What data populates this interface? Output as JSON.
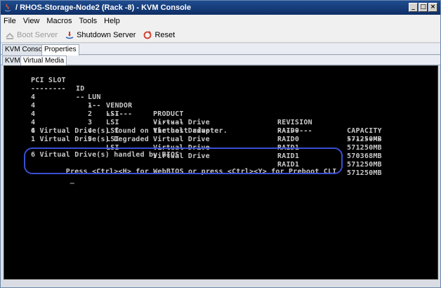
{
  "window": {
    "title": "/ RHOS-Storage-Node2 (Rack -8) - KVM Console",
    "controls": [
      "_",
      "□",
      "×"
    ]
  },
  "menu": {
    "items": [
      "File",
      "View",
      "Macros",
      "Tools",
      "Help"
    ]
  },
  "toolbar": {
    "boot_server": "Boot Server",
    "shutdown_server": "Shutdown Server",
    "reset": "Reset"
  },
  "tabs": {
    "top": [
      "KVM Console",
      "Properties"
    ],
    "sub": [
      "KVM",
      "Virtual Media"
    ]
  },
  "console": {
    "headers": [
      "PCI SLOT",
      "ID",
      "LUN",
      "VENDOR",
      "PRODUCT",
      "REVISION",
      "CAPACITY"
    ],
    "header_rule": [
      "--------",
      "--",
      "---",
      "------",
      "-------",
      "--------",
      "--------"
    ],
    "rows": [
      {
        "slot": "4",
        "id": "",
        "lun": "1",
        "vendor": "LSI",
        "product": "Virtual Drive",
        "revision": "RAID0",
        "capacity": "571250MB"
      },
      {
        "slot": "4",
        "id": "",
        "lun": "2",
        "vendor": "LSI",
        "product": "Virtual Drive",
        "revision": "RAID0",
        "capacity": "571250MB"
      },
      {
        "slot": "4",
        "id": "",
        "lun": "3",
        "vendor": "LSI",
        "product": "Virtual Drive",
        "revision": "RAID1",
        "capacity": "570368MB"
      },
      {
        "slot": "4",
        "id": "",
        "lun": "4",
        "vendor": "LSI",
        "product": "Virtual Drive",
        "revision": "RAID1",
        "capacity": "571250MB"
      },
      {
        "slot": "4",
        "id": "",
        "lun": "5",
        "vendor": "LSI",
        "product": "Virtual Drive",
        "revision": "RAID1",
        "capacity": "571250MB"
      }
    ],
    "message_found": "6 Virtual Drive(s) found on the host adapter.",
    "message_degraded": "1 Virtual Drive(s) Degraded",
    "message_bios": "6 Virtual Drive(s) handled by BIOS",
    "message_press": "Press <Ctrl><H> for WebBIOS or press <Ctrl><Y> for Preboot CLI",
    "cursor": "_"
  },
  "colors": {
    "titlebar": "#1f4c8f",
    "console_bg": "#000000",
    "console_text": "#c8c8c8",
    "highlight": "#3a4fd1"
  }
}
